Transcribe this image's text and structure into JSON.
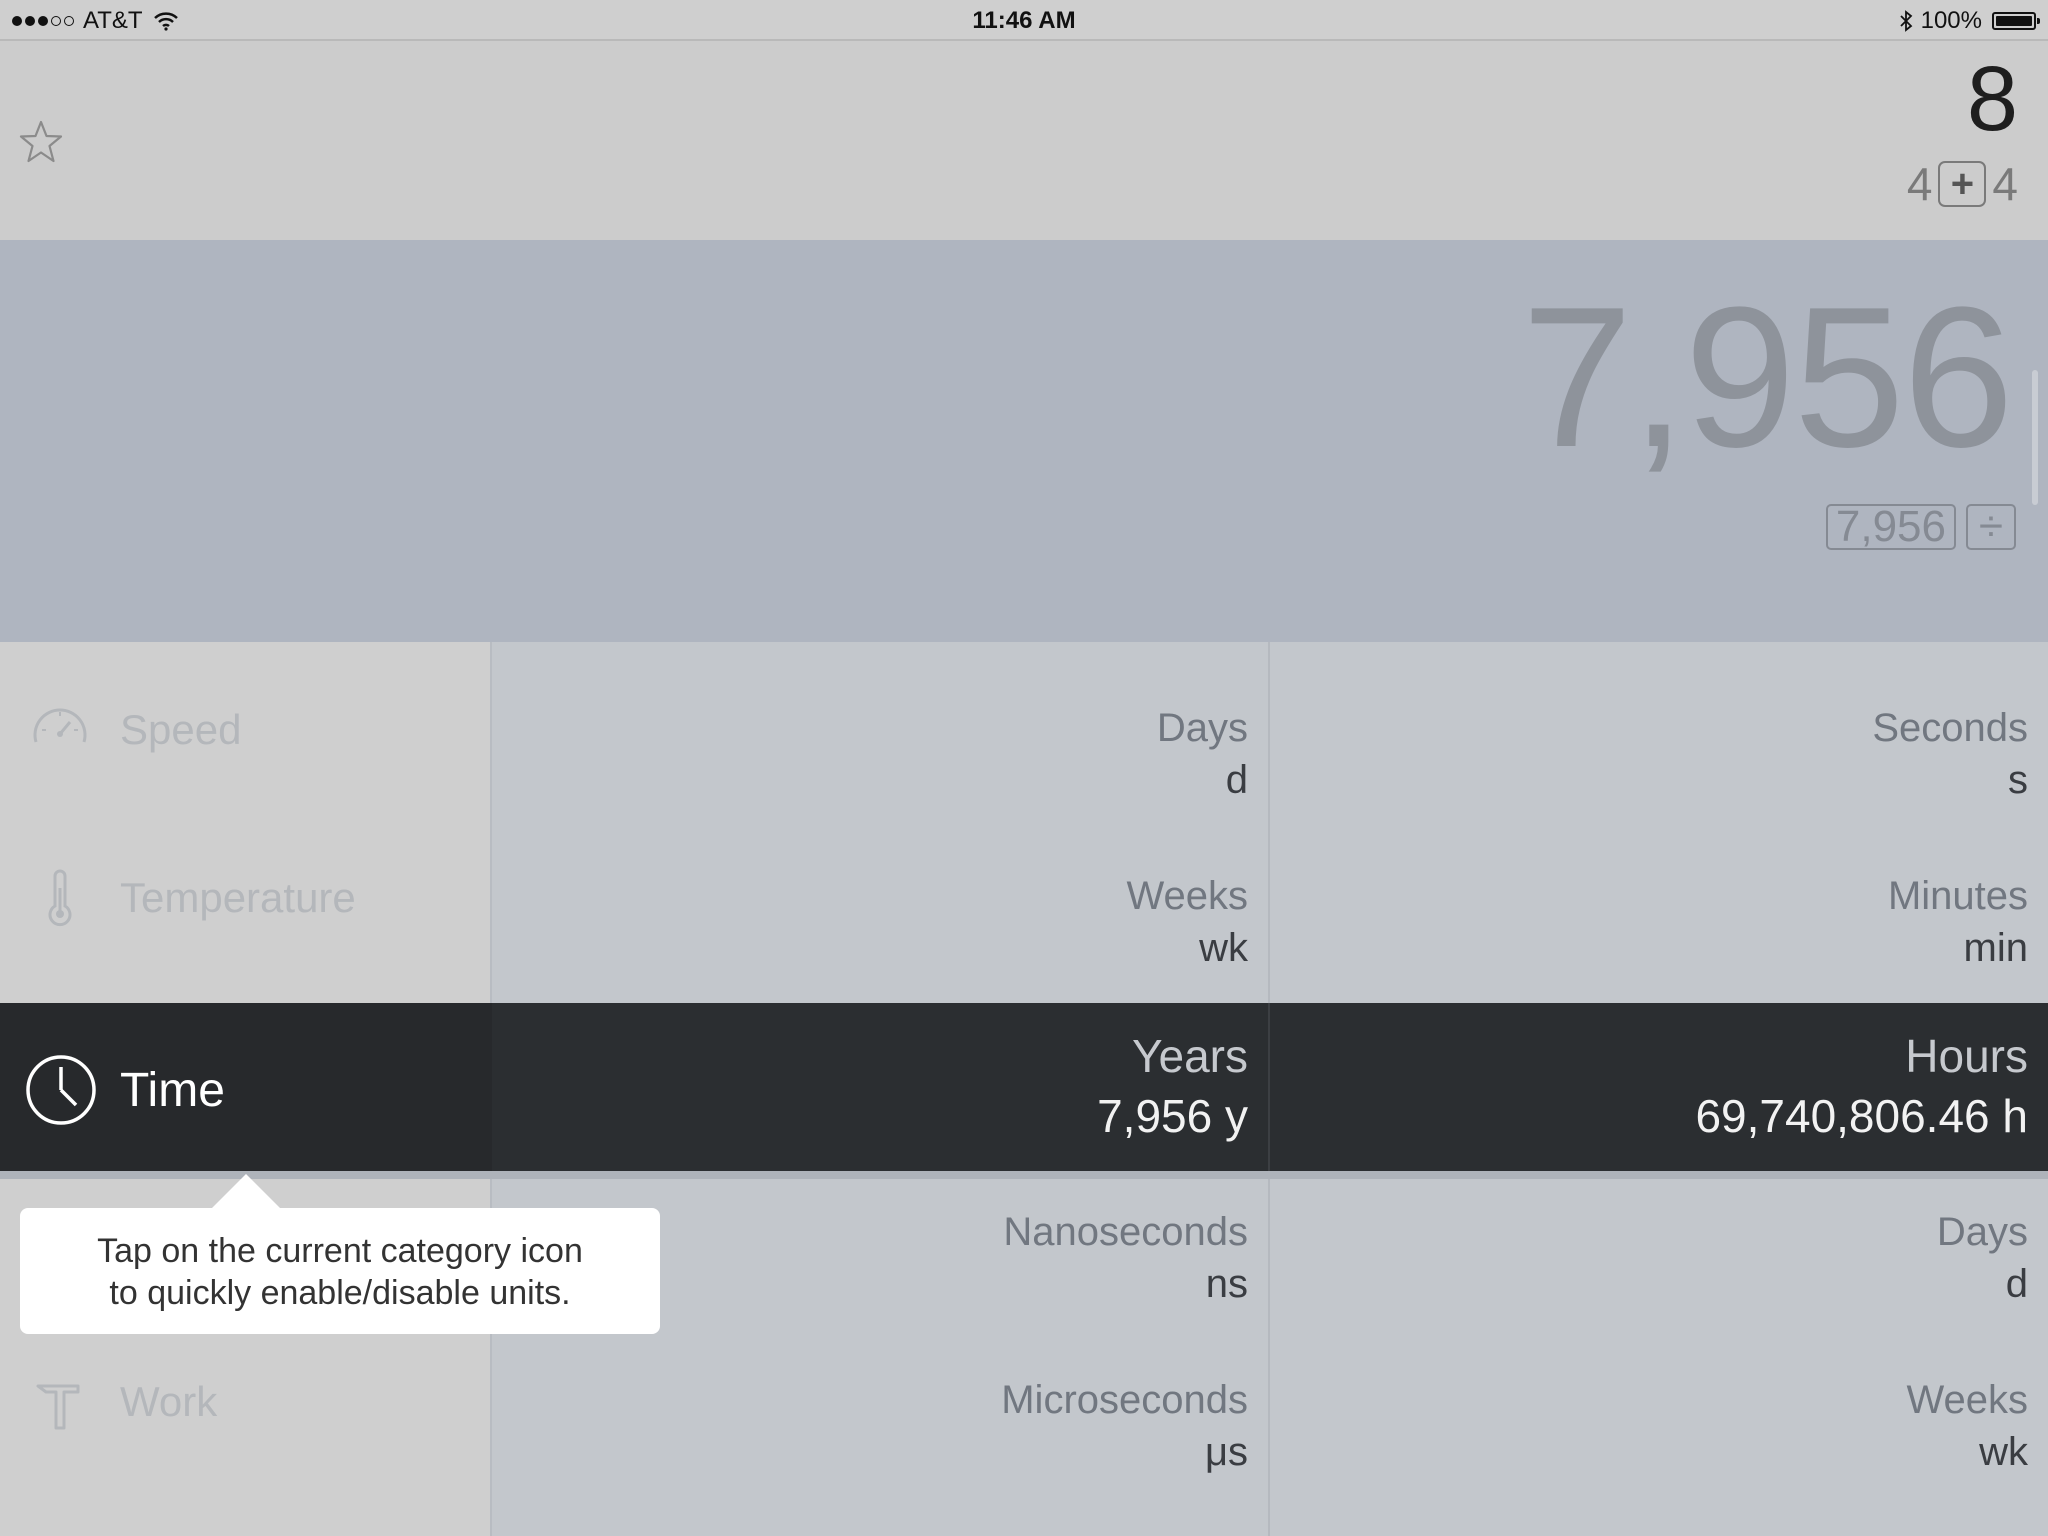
{
  "status_bar": {
    "carrier": "AT&T",
    "time": "11:46 AM",
    "battery": "100%",
    "signal_bars_filled": 3,
    "signal_bars_total": 5
  },
  "memory": {
    "total": "8",
    "left_operand": "4",
    "operator": "+",
    "right_operand": "4"
  },
  "display": {
    "value": "7,956",
    "chip_value": "7,956",
    "chip_operator": "÷"
  },
  "categories": [
    {
      "label": "Speed",
      "icon": "speedometer-icon"
    },
    {
      "label": "Temperature",
      "icon": "thermometer-icon"
    },
    {
      "label": "Time",
      "icon": "clock-icon",
      "selected": true
    },
    {
      "label": "Work",
      "icon": "hammer-icon"
    }
  ],
  "units_col1": [
    {
      "name": "Days",
      "abbr": "d"
    },
    {
      "name": "Weeks",
      "abbr": "wk"
    },
    {
      "name": "Years",
      "value": "7,956 y"
    },
    {
      "name": "Nanoseconds",
      "abbr": "ns"
    },
    {
      "name": "Microseconds",
      "abbr": "μs"
    }
  ],
  "units_col2": [
    {
      "name": "Seconds",
      "abbr": "s"
    },
    {
      "name": "Minutes",
      "abbr": "min"
    },
    {
      "name": "Hours",
      "value": "69,740,806.46 h"
    },
    {
      "name": "Days",
      "abbr": "d"
    },
    {
      "name": "Weeks",
      "abbr": "wk"
    }
  ],
  "tooltip": {
    "line1": "Tap on the current category icon",
    "line2": "to quickly enable/disable units."
  },
  "colors": {
    "selected_row": "#27292c",
    "display_bg": "#afb5c0",
    "top_bg": "#cccccc"
  }
}
